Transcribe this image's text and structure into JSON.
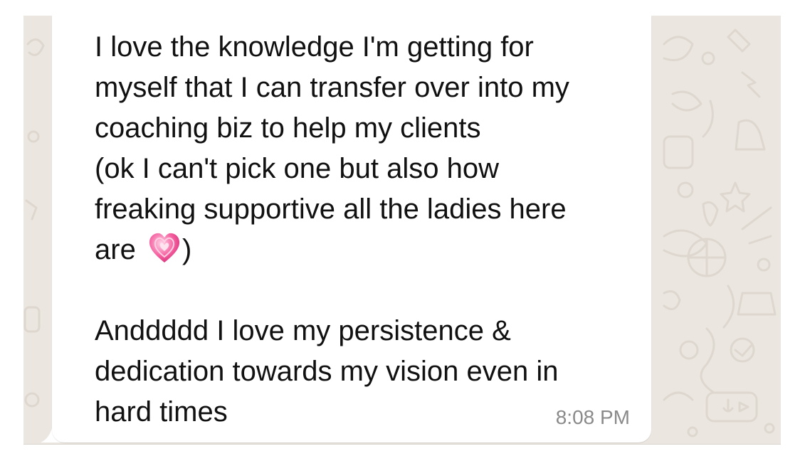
{
  "chat": {
    "message": {
      "line1": "I love the knowledge I'm getting for",
      "line2": "myself that I can transfer over into my",
      "line3": "coaching biz to help my clients",
      "line4": "(ok I can't pick one but also how",
      "line5": "freaking supportive all the ladies here",
      "line6_before": "are ",
      "line6_after": ")",
      "line8": "Anddddd I love my persistence &",
      "line9": "dedication towards my vision even in",
      "line10": "hard times",
      "emoji": "growing-heart-emoji"
    },
    "timestamp": "8:08 PM"
  },
  "colors": {
    "wallpaper": "#ebe6df",
    "bubble": "#ffffff",
    "text": "#111111",
    "timestamp": "#8a8a8a",
    "heart": "#f25a9b"
  }
}
